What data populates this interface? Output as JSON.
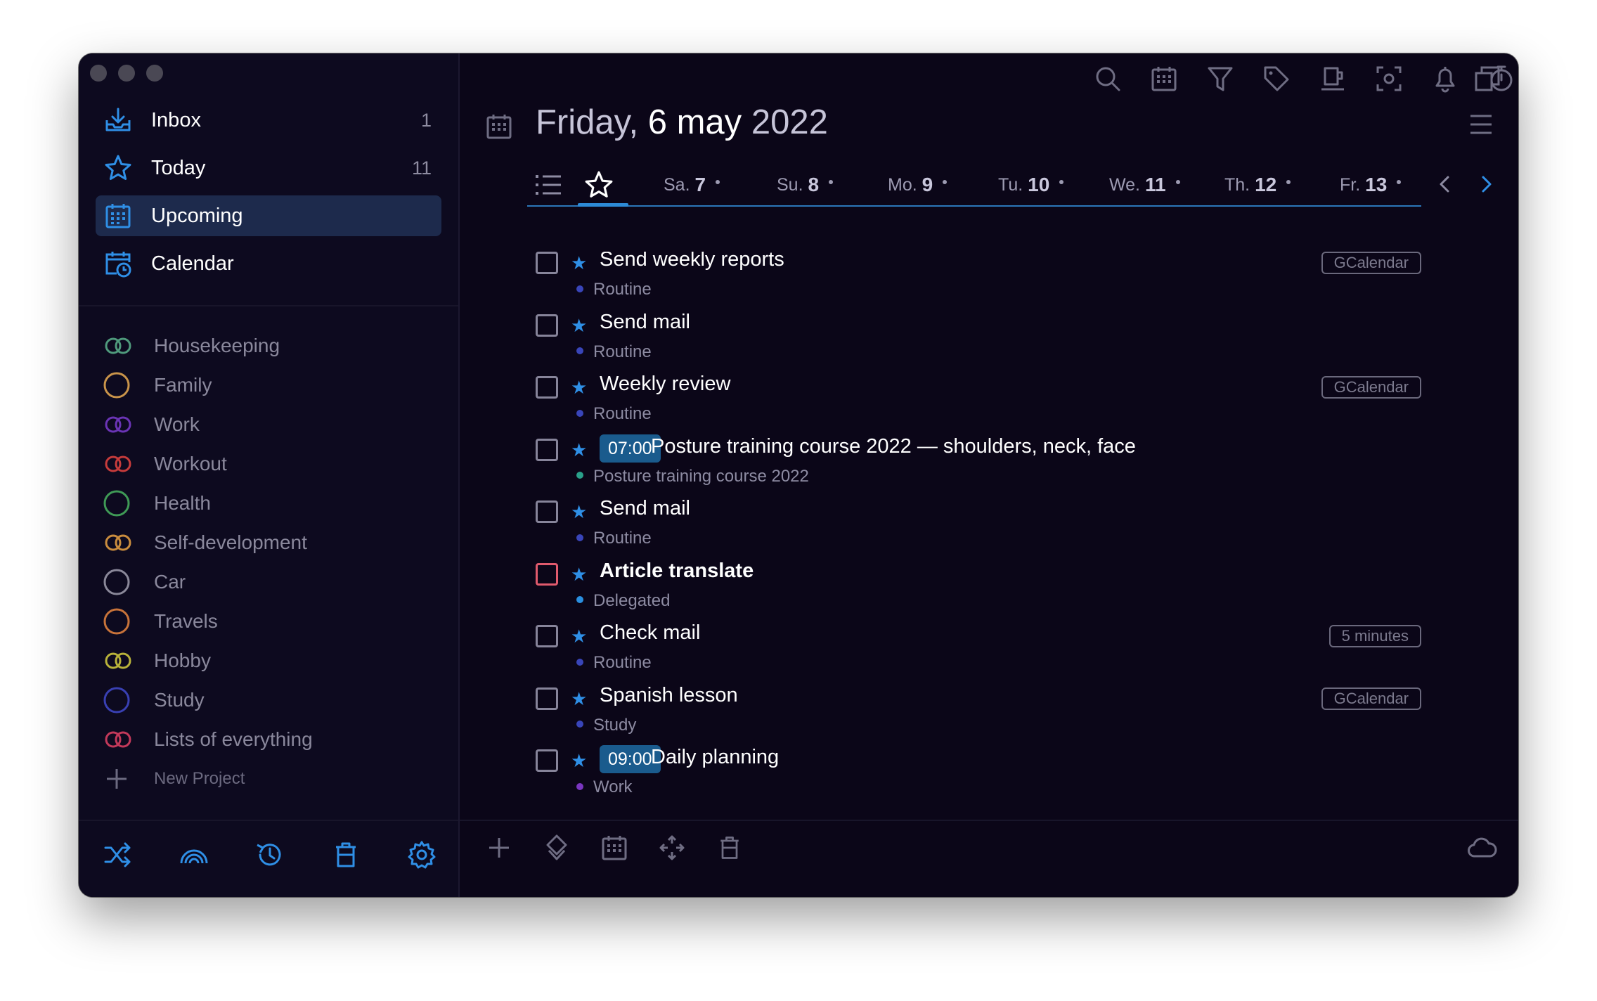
{
  "sidebar": {
    "nav": [
      {
        "label": "Inbox",
        "count": "1"
      },
      {
        "label": "Today",
        "count": "11"
      },
      {
        "label": "Upcoming",
        "count": ""
      },
      {
        "label": "Calendar",
        "count": ""
      }
    ],
    "projects": [
      {
        "label": "Housekeeping",
        "color": "#4f9a7c",
        "shape": "rings"
      },
      {
        "label": "Family",
        "color": "#c9944a",
        "shape": "circle"
      },
      {
        "label": "Work",
        "color": "#6a34b5",
        "shape": "rings"
      },
      {
        "label": "Workout",
        "color": "#c63b3b",
        "shape": "rings"
      },
      {
        "label": "Health",
        "color": "#3f9a56",
        "shape": "circle"
      },
      {
        "label": "Self-development",
        "color": "#c98c3e",
        "shape": "rings"
      },
      {
        "label": "Car",
        "color": "#8a8899",
        "shape": "circle"
      },
      {
        "label": "Travels",
        "color": "#c8733a",
        "shape": "circle"
      },
      {
        "label": "Hobby",
        "color": "#b8b23a",
        "shape": "rings"
      },
      {
        "label": "Study",
        "color": "#3940b3",
        "shape": "circle"
      },
      {
        "label": "Lists of everything",
        "color": "#c2395a",
        "shape": "rings"
      }
    ],
    "new_project_label": "New Project"
  },
  "header": {
    "weekday": "Friday,",
    "daymonth": "6 may",
    "year": "2022"
  },
  "day_tabs": [
    {
      "dow": "Sa.",
      "num": "7"
    },
    {
      "dow": "Su.",
      "num": "8"
    },
    {
      "dow": "Mo.",
      "num": "9"
    },
    {
      "dow": "Tu.",
      "num": "10"
    },
    {
      "dow": "We.",
      "num": "11"
    },
    {
      "dow": "Th.",
      "num": "12"
    },
    {
      "dow": "Fr.",
      "num": "13"
    }
  ],
  "tasks": [
    {
      "title": "Send weekly reports",
      "sub": "Routine",
      "sub_color": "#3945b9",
      "time": "",
      "badge": "GCalendar",
      "bold": false,
      "red": false
    },
    {
      "title": "Send mail",
      "sub": "Routine",
      "sub_color": "#3945b9",
      "time": "",
      "badge": "",
      "bold": false,
      "red": false
    },
    {
      "title": "Weekly review",
      "sub": "Routine",
      "sub_color": "#3945b9",
      "time": "",
      "badge": "GCalendar",
      "bold": false,
      "red": false
    },
    {
      "title": "Posture training course 2022 — shoulders, neck, face",
      "sub": "Posture training course 2022",
      "sub_color": "#2aa08a",
      "time": "07:00",
      "badge": "",
      "bold": false,
      "red": false
    },
    {
      "title": "Send mail",
      "sub": "Routine",
      "sub_color": "#3945b9",
      "time": "",
      "badge": "",
      "bold": false,
      "red": false
    },
    {
      "title": "Article translate",
      "sub": "Delegated",
      "sub_color": "#2a8fe0",
      "time": "",
      "badge": "",
      "bold": true,
      "red": true
    },
    {
      "title": "Check mail",
      "sub": "Routine",
      "sub_color": "#3945b9",
      "time": "",
      "badge": "5 minutes",
      "bold": false,
      "red": false
    },
    {
      "title": "Spanish lesson",
      "sub": "Study",
      "sub_color": "#3945b9",
      "time": "",
      "badge": "GCalendar",
      "bold": false,
      "red": false
    },
    {
      "title": "Daily planning",
      "sub": "Work",
      "sub_color": "#7a36c0",
      "time": "09:00",
      "badge": "",
      "bold": false,
      "red": false
    }
  ],
  "colors": {
    "accent": "#2d8ad6",
    "background": "#0b0618",
    "sidebar": "#0d0a1f",
    "active": "#1d2a4c"
  }
}
